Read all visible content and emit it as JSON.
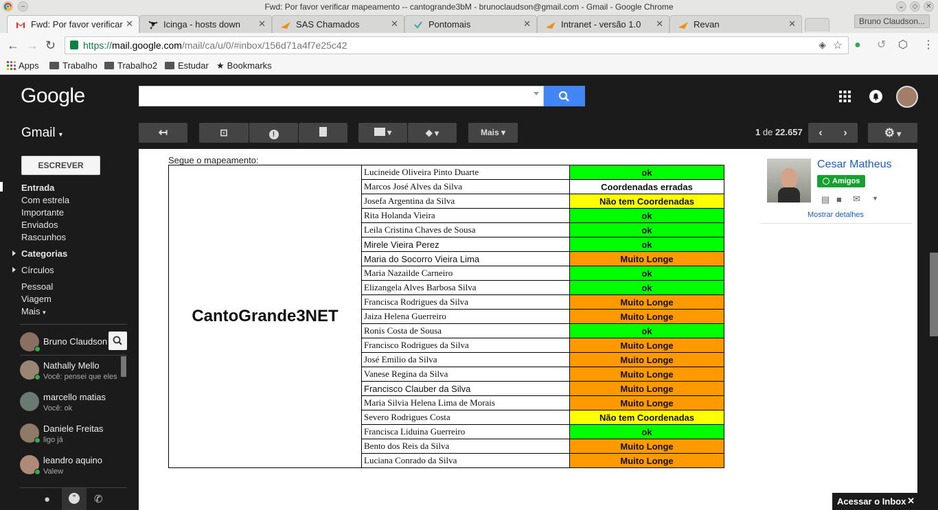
{
  "window": {
    "title": "Fwd: Por favor verificar mapeamento -- cantogrande3bM - brunoclaudson@gmail.com - Gmail - Google Chrome",
    "profile": "Bruno Claudson..."
  },
  "tabs": [
    {
      "label": "Fwd: Por favor verificar",
      "icon": "gmail-icon",
      "color": "#d93025"
    },
    {
      "label": "Icinga - hosts down",
      "icon": "icinga-icon",
      "color": "#333333"
    },
    {
      "label": "SAS Chamados",
      "icon": "sas-icon",
      "color": "#f29111"
    },
    {
      "label": "Pontomais",
      "icon": "check-icon",
      "color": "#3aa3a3"
    },
    {
      "label": "Intranet - versão 1.0",
      "icon": "sas-icon",
      "color": "#f29111"
    },
    {
      "label": "Revan",
      "icon": "sas-icon",
      "color": "#f29111"
    }
  ],
  "url": {
    "scheme": "https://",
    "host": "mail.google.com",
    "path": "/mail/ca/u/0/#inbox/156d71a4f7e25c42"
  },
  "bookmarks": [
    "Apps",
    "Trabalho",
    "Trabalho2",
    "Estudar",
    "Bookmarks"
  ],
  "gmail": {
    "logo": "Google",
    "label": "Gmail",
    "more_label": "Mais",
    "pager": {
      "start": "1",
      "of": "de",
      "total": "22.657"
    }
  },
  "sidebar": {
    "compose": "ESCREVER",
    "items": [
      "Entrada",
      "Com estrela",
      "Importante",
      "Enviados",
      "Rascunhos",
      "Categorias",
      "Círculos",
      "Pessoal",
      "Viagem",
      "Mais"
    ],
    "chat_self": "Bruno Claudson",
    "chats": [
      {
        "name": "Nathally Mello",
        "status": "Você: pensei que eles"
      },
      {
        "name": "marcello matias",
        "status": "Você: ok"
      },
      {
        "name": "Daniele Freitas",
        "status": "ligo já"
      },
      {
        "name": "leandro aquino",
        "status": "Valew"
      }
    ]
  },
  "email": {
    "intro": "Segue o mapeamento:",
    "group_name": "CantoGrande3NET",
    "rows": [
      {
        "name": "Lucineide Oliveira Pinto Duarte",
        "status": "ok",
        "color": "#00ff00"
      },
      {
        "name": "Marcos José Alves da Silva",
        "status": "Coordenadas erradas",
        "color": "#ffffff"
      },
      {
        "name": "Josefa Argentina da Silva",
        "status": "Não tem Coordenadas",
        "color": "#ffff00"
      },
      {
        "name": "Rita Holanda Vieira",
        "status": "ok",
        "color": "#00ff00"
      },
      {
        "name": "Leila Cristina Chaves de Sousa",
        "status": "ok",
        "color": "#00ff00"
      },
      {
        "name": "Mirele Vieira Perez",
        "status": "ok",
        "color": "#00ff00"
      },
      {
        "name": "Maria do Socorro Vieira Lima",
        "status": "Muito Longe",
        "color": "#ff9900"
      },
      {
        "name": "Maria Nazailde Carneiro",
        "status": "ok",
        "color": "#00ff00"
      },
      {
        "name": "Elizangela Alves Barbosa Silva",
        "status": "ok",
        "color": "#00ff00"
      },
      {
        "name": "Francisca Rodrigues da Silva",
        "status": "Muito Longe",
        "color": "#ff9900"
      },
      {
        "name": "Jaiza Helena Guerreiro",
        "status": "Muito Longe",
        "color": "#ff9900"
      },
      {
        "name": "Ronis Costa de Sousa",
        "status": "ok",
        "color": "#00ff00"
      },
      {
        "name": "Francisco Rodrigues da Silva",
        "status": "Muito Longe",
        "color": "#ff9900"
      },
      {
        "name": "José Emilio da Silva",
        "status": "Muito Longe",
        "color": "#ff9900"
      },
      {
        "name": "Vanese Regina da Silva",
        "status": "Muito Longe",
        "color": "#ff9900"
      },
      {
        "name": "Francisco Clauber da Silva",
        "status": "Muito Longe",
        "color": "#ff9900"
      },
      {
        "name": "Maria Silvia Helena Lima de Morais",
        "status": "Muito Longe",
        "color": "#ff9900"
      },
      {
        "name": "Severo Rodrigues Costa",
        "status": "Não tem Coordenadas",
        "color": "#ffff00"
      },
      {
        "name": "Francisca Liduina Guerreiro",
        "status": "ok",
        "color": "#00ff00"
      },
      {
        "name": "Bento dos Reis da Silva",
        "status": "Muito Longe",
        "color": "#ff9900"
      },
      {
        "name": "Luciana Conrado da Silva",
        "status": "Muito Longe",
        "color": "#ff9900"
      }
    ]
  },
  "contact": {
    "name": "Cesar Matheus",
    "tag": "Amigos",
    "details_link": "Mostrar detalhes"
  },
  "inbox_button": "Acessar o Inbox"
}
